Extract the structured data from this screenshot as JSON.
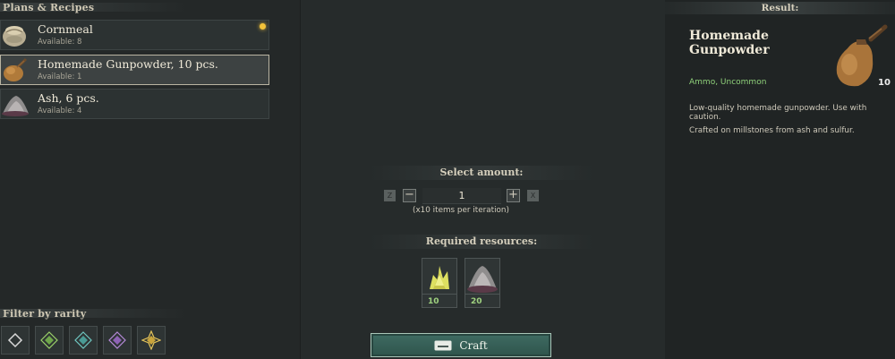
{
  "left_panel": {
    "title": "Plans & Recipes",
    "recipes": [
      {
        "name": "Cornmeal",
        "available": "Available: 8",
        "icon": "cornmeal-sack-icon",
        "new": true
      },
      {
        "name": "Homemade Gunpowder, 10 pcs.",
        "available": "Available: 1",
        "icon": "gunpowder-flask-icon",
        "selected": true
      },
      {
        "name": "Ash, 6 pcs.",
        "available": "Available: 4",
        "icon": "ash-pile-icon"
      }
    ],
    "filter_title": "Filter by rarity",
    "rarity_filters": [
      {
        "name": "common",
        "color": "#cfcfcf"
      },
      {
        "name": "uncommon",
        "color": "#9bd26a"
      },
      {
        "name": "rare",
        "color": "#6fc6c0"
      },
      {
        "name": "epic",
        "color": "#b58ad8"
      },
      {
        "name": "legendary",
        "color": "#e3c35a"
      }
    ]
  },
  "center_panel": {
    "select_amount_title": "Select amount:",
    "decrease_key": "Z",
    "increase_key": "X",
    "minus": "−",
    "plus": "+",
    "amount": "1",
    "per_iteration": "(x10 items per iteration)",
    "resources_title": "Required resources:",
    "resources": [
      {
        "name": "sulfur",
        "icon": "sulfur-crystal-icon",
        "qty": "10"
      },
      {
        "name": "ash",
        "icon": "ash-pile-icon",
        "qty": "20"
      }
    ],
    "craft_label": "Craft",
    "craft_key_icon": "spacebar-key-icon"
  },
  "right_panel": {
    "title": "Result:",
    "item_name": "Homemade Gunpowder",
    "category": "Ammo, Uncommon",
    "count": "10",
    "description": "Low-quality homemade gunpowder. Use with caution.",
    "crafted_on": "Crafted on millstones from ash and sulfur."
  },
  "colors": {
    "accent_green": "#8fd17a",
    "craft_button": "#3f6b62",
    "new_indicator": "#f3c33a"
  }
}
